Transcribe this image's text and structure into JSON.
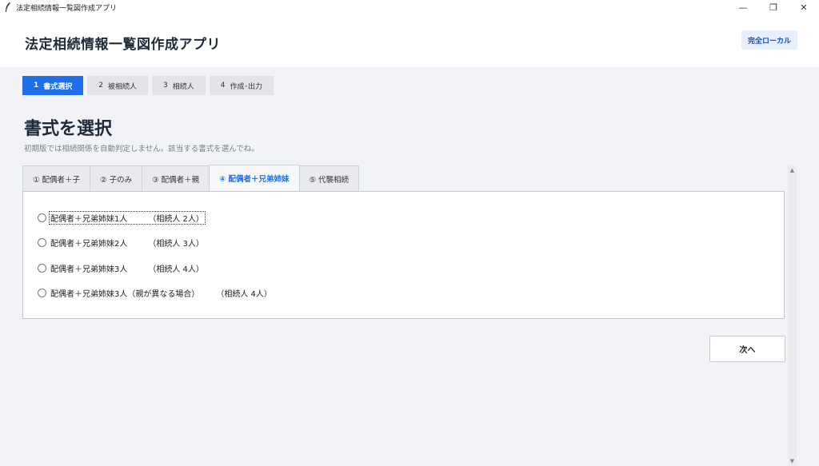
{
  "window": {
    "title": "法定相続情報一覧図作成アプリ",
    "controls": {
      "minimize": "—",
      "restore": "❐",
      "close": "✕"
    }
  },
  "header": {
    "app_title": "法定相続情報一覧図作成アプリ",
    "badge": "完全ローカル"
  },
  "steps": [
    {
      "num": "1",
      "label": "書式選択",
      "active": true
    },
    {
      "num": "2",
      "label": "被相続人",
      "active": false
    },
    {
      "num": "3",
      "label": "相続人",
      "active": false
    },
    {
      "num": "4",
      "label": "作成･出力",
      "active": false
    }
  ],
  "page": {
    "heading": "書式を選択",
    "subtitle": "初期版では相続関係を自動判定しません。該当する書式を選んでね。"
  },
  "tabs": [
    {
      "label": "① 配偶者＋子",
      "active": false
    },
    {
      "label": "② 子のみ",
      "active": false
    },
    {
      "label": "③ 配偶者＋親",
      "active": false
    },
    {
      "label": "④ 配偶者＋兄弟姉妹",
      "active": true
    },
    {
      "label": "⑤ 代襲相続",
      "active": false
    }
  ],
  "options": [
    {
      "label": "配偶者＋兄弟姉妹1人",
      "heirs": "（相続人 2人）"
    },
    {
      "label": "配偶者＋兄弟姉妹2人",
      "heirs": "（相続人 3人）"
    },
    {
      "label": "配偶者＋兄弟姉妹3人",
      "heirs": "（相続人 4人）"
    },
    {
      "label": "配偶者＋兄弟姉妹3人（親が異なる場合）",
      "heirs": "（相続人 4人）"
    }
  ],
  "buttons": {
    "next": "次へ"
  },
  "scrollbar": {
    "up": "▲",
    "down": "▼"
  }
}
